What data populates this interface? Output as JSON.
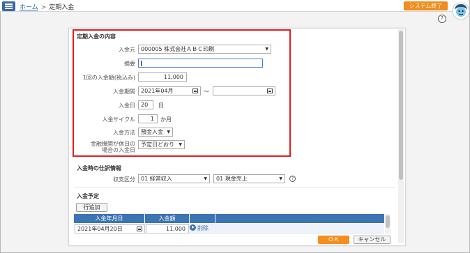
{
  "breadcrumb": {
    "home": "ホーム",
    "separator": ">",
    "current": "定期入金"
  },
  "header": {
    "system_exit_label": "システム終了",
    "help_icon_glyph": "?"
  },
  "form": {
    "section_title": "定期入金の内容",
    "payer": {
      "label": "入金元",
      "value": "000005 株式会社ＡＢＣ印刷"
    },
    "memo": {
      "label": "摘要",
      "value": ""
    },
    "amount": {
      "label": "1回の入金額(税込み)",
      "value": "11,000"
    },
    "period": {
      "label": "入金期間",
      "start": "2021年04月",
      "tilde": "〜",
      "end": ""
    },
    "day": {
      "label": "入金日",
      "value": "20",
      "unit": "日"
    },
    "cycle": {
      "label": "入金サイクル",
      "value": "1",
      "unit": "か月"
    },
    "method": {
      "label": "入金方法",
      "value": "預金入金"
    },
    "holiday": {
      "label_line1": "金融機関が休日の",
      "label_line2": "場合の入金日",
      "value": "予定日どおり"
    }
  },
  "journal": {
    "section_title": "入金時の仕訳情報",
    "label": "収支区分",
    "category1": "01 経常収入",
    "category2": "01 現金売上",
    "help_glyph": "?"
  },
  "schedule": {
    "section_title": "入金予定",
    "add_row_label": "行追加",
    "columns": [
      "入金年月日",
      "入金額"
    ],
    "rows": [
      {
        "date": "2021年04月20日",
        "amount": "11,000",
        "delete_label": "削除"
      }
    ]
  },
  "footer": {
    "ok_label": "ＯＫ",
    "cancel_label": "キャンセル"
  },
  "colors": {
    "accent_orange": "#f08d1e",
    "table_header_blue": "#3d74b3",
    "highlight_red": "#e01e1e",
    "link_blue": "#2a67b5"
  },
  "icons": [
    "menu-icon",
    "avatar-icon",
    "help-icon",
    "calendar-icon",
    "dropdown-arrow-icon",
    "play-icon"
  ]
}
